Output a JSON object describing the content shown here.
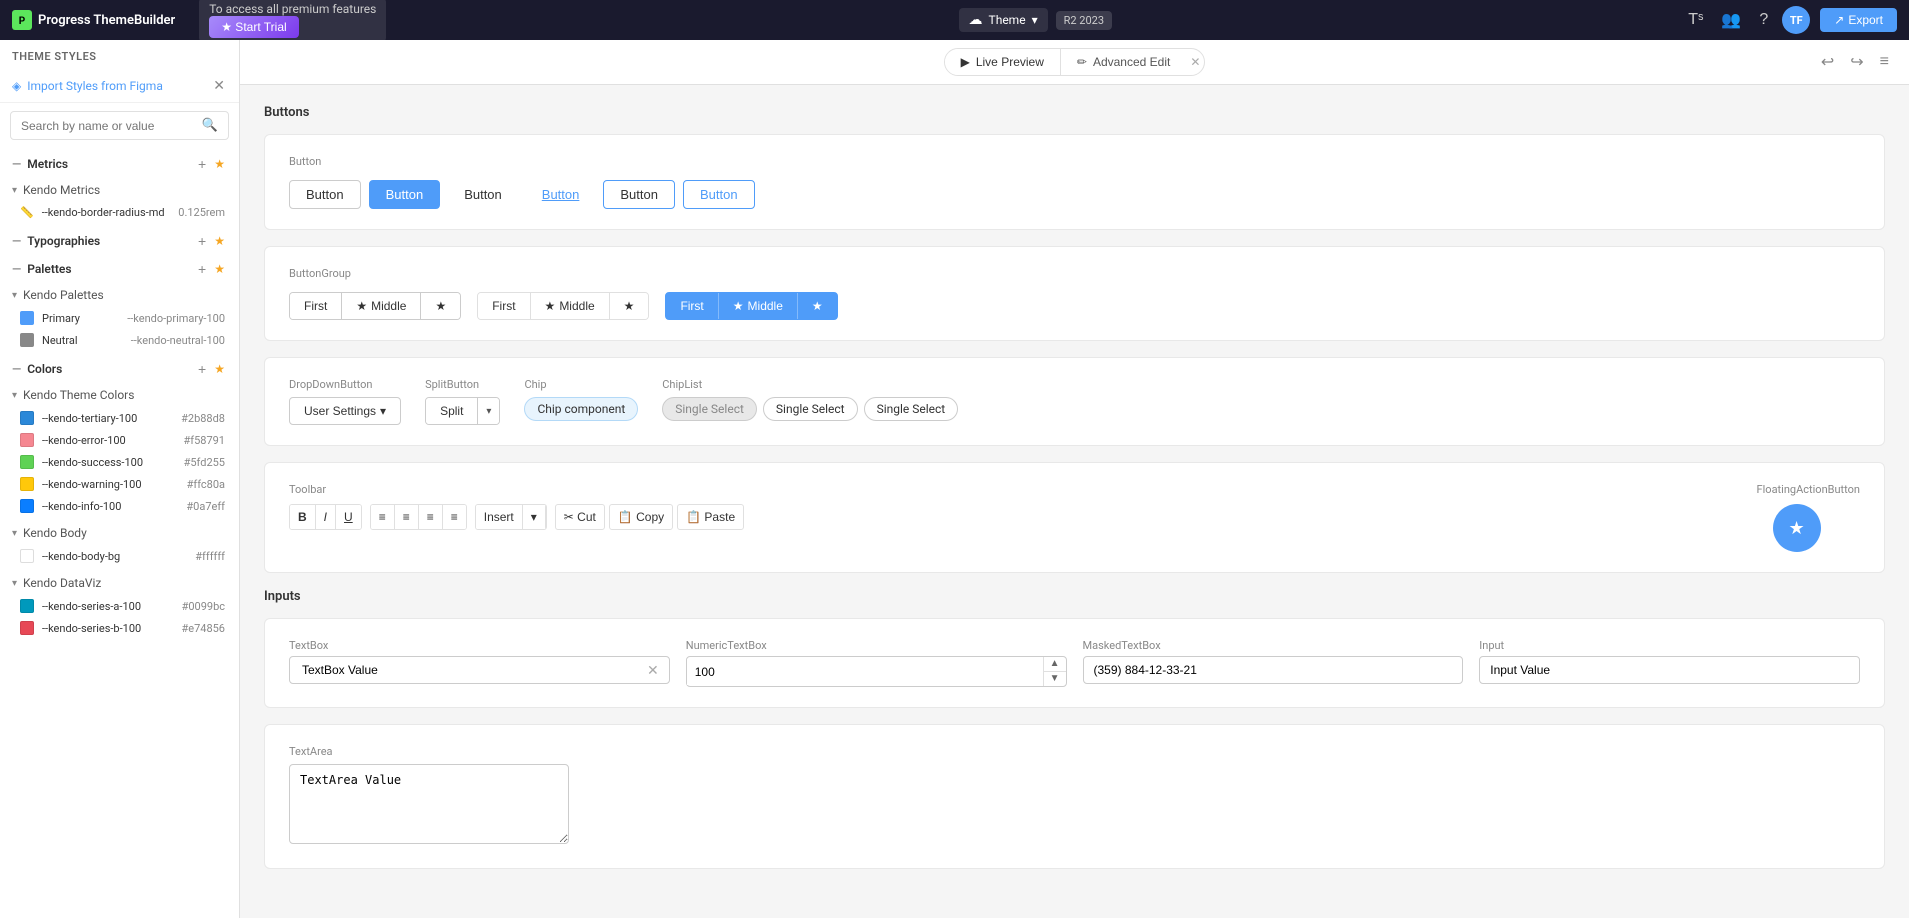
{
  "topbar": {
    "logo": "P",
    "app_name": "Progress ThemeBuilder",
    "promo_text": "To access all premium features",
    "start_trial": "★ Start Trial",
    "theme_label": "Theme",
    "version": "R2 2023",
    "export_label": "Export",
    "avatar": "TF"
  },
  "content_toolbar": {
    "live_preview": "Live Preview",
    "advanced_edit": "Advanced Edit",
    "close_icon": "✕"
  },
  "sidebar": {
    "title": "THEME STYLES",
    "import_label": "Import Styles from Figma",
    "search_placeholder": "Search by name or value",
    "sections": {
      "metrics": {
        "label": "Metrics",
        "kendo_metrics": {
          "label": "Kendo Metrics",
          "items": [
            {
              "name": "--kendo-border-radius-md",
              "value": "0.125rem"
            }
          ]
        }
      },
      "typographies": {
        "label": "Typographies"
      },
      "palettes": {
        "label": "Palettes",
        "kendo_palettes": {
          "label": "Kendo Palettes",
          "items": [
            {
              "name": "Primary",
              "css_var": "--kendo-primary-100",
              "color": "#4f9cf9"
            },
            {
              "name": "Neutral",
              "css_var": "--kendo-neutral-100",
              "color": "#888888"
            }
          ]
        }
      },
      "colors": {
        "label": "Colors",
        "kendo_theme_colors": {
          "label": "Kendo Theme Colors",
          "items": [
            {
              "name": "--kendo-tertiary-100",
              "value": "#2b88d8",
              "color": "#2b88d8"
            },
            {
              "name": "--kendo-error-100",
              "value": "#f58791",
              "color": "#f58791"
            },
            {
              "name": "--kendo-success-100",
              "value": "#5fd255",
              "color": "#5fd255"
            },
            {
              "name": "--kendo-warning-100",
              "value": "#ffc80a",
              "color": "#ffc80a"
            },
            {
              "name": "--kendo-info-100",
              "value": "#0a7eff",
              "color": "#0a7eff"
            }
          ]
        },
        "kendo_body": {
          "label": "Kendo Body",
          "items": [
            {
              "name": "--kendo-body-bg",
              "value": "#ffffff",
              "color": "#ffffff"
            }
          ]
        },
        "kendo_dataviz": {
          "label": "Kendo DataViz",
          "items": [
            {
              "name": "--kendo-series-a-100",
              "value": "#0099bc",
              "color": "#0099bc"
            },
            {
              "name": "--kendo-series-b-100",
              "value": "#e74856",
              "color": "#e74856"
            }
          ]
        }
      }
    }
  },
  "preview": {
    "buttons_section": "Buttons",
    "button_label": "Button",
    "buttons": [
      {
        "label": "Button",
        "variant": "default"
      },
      {
        "label": "Button",
        "variant": "primary"
      },
      {
        "label": "Button",
        "variant": "flat"
      },
      {
        "label": "Button",
        "variant": "link"
      },
      {
        "label": "Button",
        "variant": "outline"
      },
      {
        "label": "Button",
        "variant": "outline-blue"
      }
    ],
    "button_group_label": "ButtonGroup",
    "button_group1": [
      "First",
      "★ Middle",
      "★"
    ],
    "button_group2": [
      "First",
      "★ Middle",
      "★"
    ],
    "button_group3": [
      "First",
      "★ Middle",
      "★"
    ],
    "dropdown_button_label": "DropDownButton",
    "dropdown_button_text": "User Settings",
    "split_button_label": "SplitButton",
    "split_button_text": "Split",
    "chip_label": "Chip",
    "chip_text": "Chip component",
    "chip_list_label": "ChipList",
    "chips": [
      "Single Select",
      "Single Select",
      "Single Select"
    ],
    "toolbar_label": "Toolbar",
    "toolbar_items": [
      "B",
      "I",
      "U",
      "≡",
      "≡",
      "≡",
      "≡"
    ],
    "toolbar_insert": "Insert",
    "toolbar_cut": "✂ Cut",
    "toolbar_copy": "📋 Copy",
    "toolbar_paste": "📋 Paste",
    "fab_label": "FloatingActionButton",
    "fab_icon": "★",
    "inputs_section": "Inputs",
    "textbox_label": "TextBox",
    "textbox_value": "TextBox Value",
    "numeric_label": "NumericTextBox",
    "numeric_value": "100",
    "masked_label": "MaskedTextBox",
    "masked_value": "(359) 884-12-33-21",
    "input_label": "Input",
    "input_value": "Input Value",
    "textarea_label": "TextArea",
    "textarea_value": "TextArea Value"
  }
}
